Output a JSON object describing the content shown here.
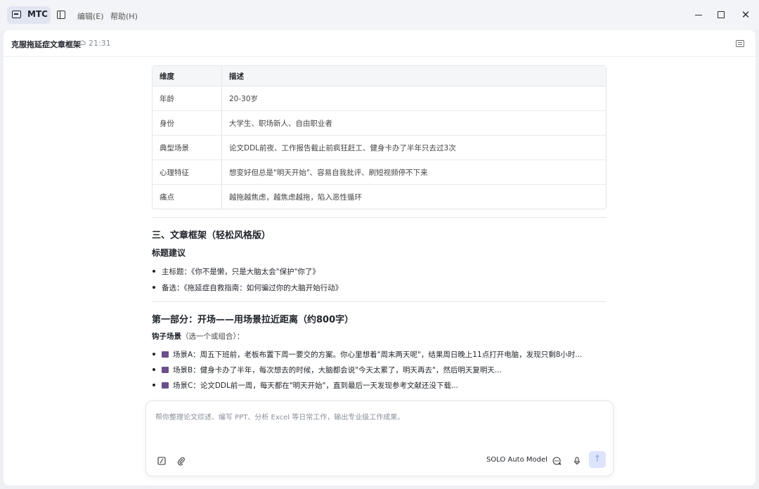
{
  "app": {
    "name": "MTC"
  },
  "menu": {
    "edit": "编辑(E)",
    "help": "帮助(H)"
  },
  "document": {
    "title": "克服拖延症文章框架",
    "saved_time": "21:31"
  },
  "table": {
    "headers": [
      "维度",
      "描述"
    ],
    "rows": [
      [
        "年龄",
        "20-30岁"
      ],
      [
        "身份",
        "大学生、职场新人、自由职业者"
      ],
      [
        "典型场景",
        "论文DDL前夜、工作报告截止前疯狂赶工、健身卡办了半年只去过3次"
      ],
      [
        "心理特征",
        "想变好但总是\"明天开始\"、容易自我批评、刷短视频停不下来"
      ],
      [
        "痛点",
        "越拖越焦虑，越焦虑越拖，陷入恶性循环"
      ]
    ]
  },
  "section3": {
    "heading": "三、文章框架（轻松风格版）",
    "title_suggestion_heading": "标题建议",
    "items": [
      "主标题：《你不是懒，只是大脑太会\"保护\"你了》",
      "备选：《拖延症自救指南：如何骗过你的大脑开始行动》"
    ]
  },
  "part1": {
    "heading": "第一部分：开场——用场景拉近距离（约800字）",
    "hook_label": "钩子场景",
    "hook_hint": "（选一个或组合）：",
    "scenes": [
      "场景A：周五下班前，老板布置下周一要交的方案。你心里想着\"周末两天呢\"，结果周日晚上11点打开电脑，发现只剩8小时...",
      "场景B：健身卡办了半年，每次想去的时候，大脑都会说\"今天太累了，明天再去\"，然后明天复明天...",
      "场景C：论文DDL前一周，每天都在\"明天开始\"，直到最后一天发现参考文献还没下载..."
    ]
  },
  "composer": {
    "placeholder": "帮你整理论文综述、编写 PPT、分析 Excel 等日常工作，输出专业级工作成果。",
    "model": "SOLO Auto Model"
  }
}
